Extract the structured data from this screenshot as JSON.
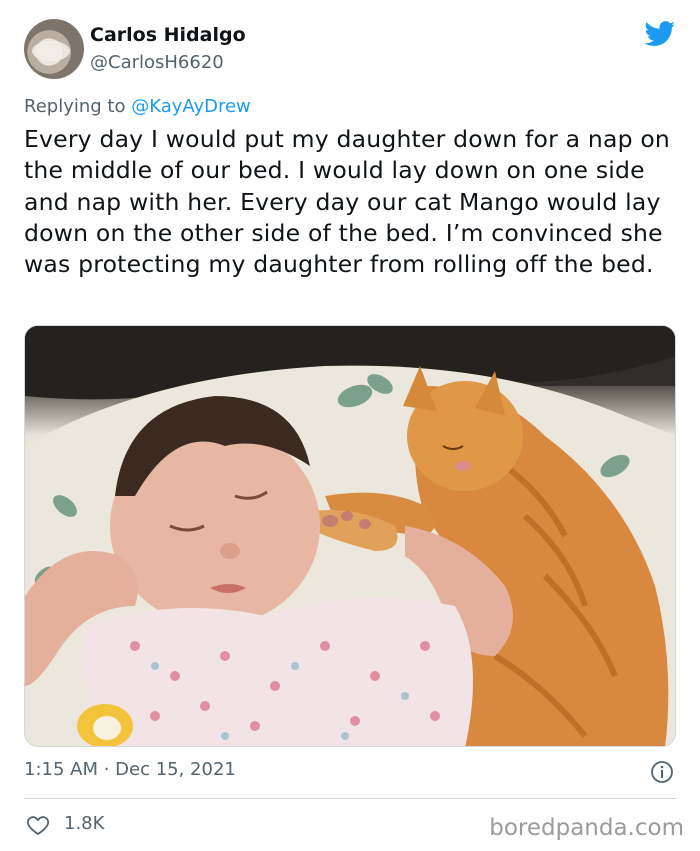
{
  "author": {
    "name": "Carlos Hidalgo",
    "handle": "@CarlosH6620"
  },
  "reply": {
    "prefix": "Replying to ",
    "mention": "@KayAyDrew"
  },
  "tweet": {
    "text": "Every day I would put my daughter down for a nap on the middle of our bed. I would lay down on one side and nap with her. Every day our cat Mango would lay down on the other side of the bed. I’m convinced she was protecting my daughter from rolling off the bed."
  },
  "meta": {
    "timestamp": "1:15 AM · Dec 15, 2021",
    "likes": "1.8K"
  },
  "watermark": "boredpanda.com",
  "colors": {
    "twitter_blue": "#1d9bf0",
    "secondary_text": "#536471",
    "divider": "#cfd9de"
  },
  "icons": {
    "brand": "twitter-bird-icon",
    "info": "info-icon",
    "like": "heart-icon"
  }
}
